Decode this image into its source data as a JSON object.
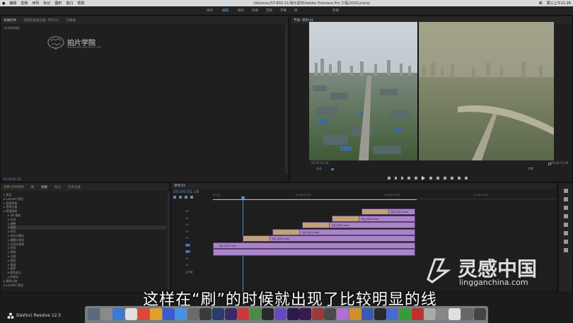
{
  "menubar": {
    "items": [
      "编辑",
      "剪辑",
      "序列",
      "标记",
      "图形",
      "窗口",
      "帮助"
    ],
    "doc_title": "/Volumes/ST-800-11/演示素材/Adobe Premiere Pro 工程/2020.prproj",
    "clock": "周三上午11:26",
    "lang": "美"
  },
  "workspaces": {
    "items": [
      "组件",
      "编辑",
      "颜色",
      "效果",
      "音频",
      "字幕",
      "库",
      "剪辑"
    ]
  },
  "effects_panel": {
    "tabs": [
      "效果控件",
      "音频剪辑混合器: 序列 01",
      "元数据"
    ],
    "no_clip_text": "(未选择剪辑)",
    "timecode": "00:00:01:18"
  },
  "logo": {
    "name": "拍片学院",
    "sub": "WWW.LINGGANCHINA.COM"
  },
  "program_monitor": {
    "title": "节目: 序列 01",
    "timecode_in": "00:00:01:18",
    "fit": "适合",
    "quality": "完整",
    "timecode_out": "00:00:11:09"
  },
  "project_panel": {
    "tabs": [
      "项目:示例项目",
      "库",
      "效果",
      "标记",
      "历史记录"
    ],
    "tree": [
      "预设",
      "Lumetri 预设",
      "音频效果",
      "音频过渡",
      "视频效果",
      "3D 通道",
      "生成",
      "调整",
      "扭曲",
      "时间",
      "杂色与颗粒",
      "模糊与锐化",
      "沉浸式视频",
      "生成",
      "视频",
      "过渡",
      "透视",
      "通道",
      "键控",
      "颜色校正",
      "风格化",
      "视频过渡",
      "Lumetri 预设"
    ]
  },
  "timeline": {
    "tab": "序列 01",
    "timecode": "00:00:01:18",
    "ruler": [
      "00:00",
      "00:00:05:00",
      "00:00:10:00",
      "00:00:15:00"
    ],
    "tracks": [
      "V6",
      "V5",
      "V4",
      "V3",
      "V2",
      "V1",
      "A1",
      "A2",
      "A3",
      "主声道"
    ],
    "clip_label": "DJI_0022.mov"
  },
  "subtitle": "这样在“刷”的时候就出现了比较明显的线",
  "taskbar": {
    "app_name": "DaVinci Resolve 12.5"
  },
  "watermark": {
    "brand": "灵感中国",
    "url": "lingganchina.com"
  }
}
